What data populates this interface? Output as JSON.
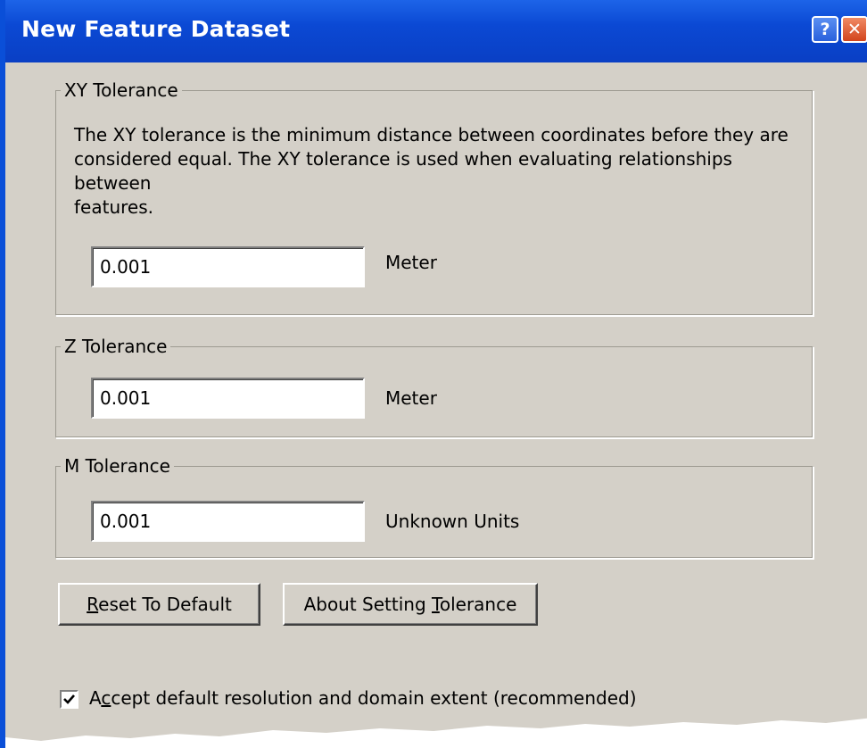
{
  "window": {
    "title": "New Feature Dataset",
    "help_glyph": "?",
    "close_glyph": "✕"
  },
  "xy_tolerance": {
    "group_label": "XY Tolerance",
    "description": "The XY tolerance is the minimum distance between coordinates before they are considered equal. The XY tolerance is used when evaluating relationships between features.",
    "description_lines": [
      "The XY tolerance is the minimum distance between coordinates before they are",
      "considered equal. The XY tolerance is used when evaluating relationships between",
      "features."
    ],
    "value": "0.001",
    "unit": "Meter"
  },
  "z_tolerance": {
    "group_label": "Z Tolerance",
    "value": "0.001",
    "unit": "Meter"
  },
  "m_tolerance": {
    "group_label": "M Tolerance",
    "value": "0.001",
    "unit": "Unknown Units"
  },
  "buttons": {
    "reset": {
      "label_before": "",
      "label_accel": "R",
      "label_after": "eset To Default"
    },
    "about": {
      "label_before": "About Setting ",
      "label_accel": "T",
      "label_after": "olerance"
    }
  },
  "accept_default": {
    "checked": true,
    "label_before": "A",
    "label_accel": "c",
    "label_after": "cept default resolution and domain extent (recommended)"
  },
  "colors": {
    "titlebar": "#0a4fd8",
    "dialog_face": "#d4d0c8",
    "close_button": "#d2441c"
  }
}
